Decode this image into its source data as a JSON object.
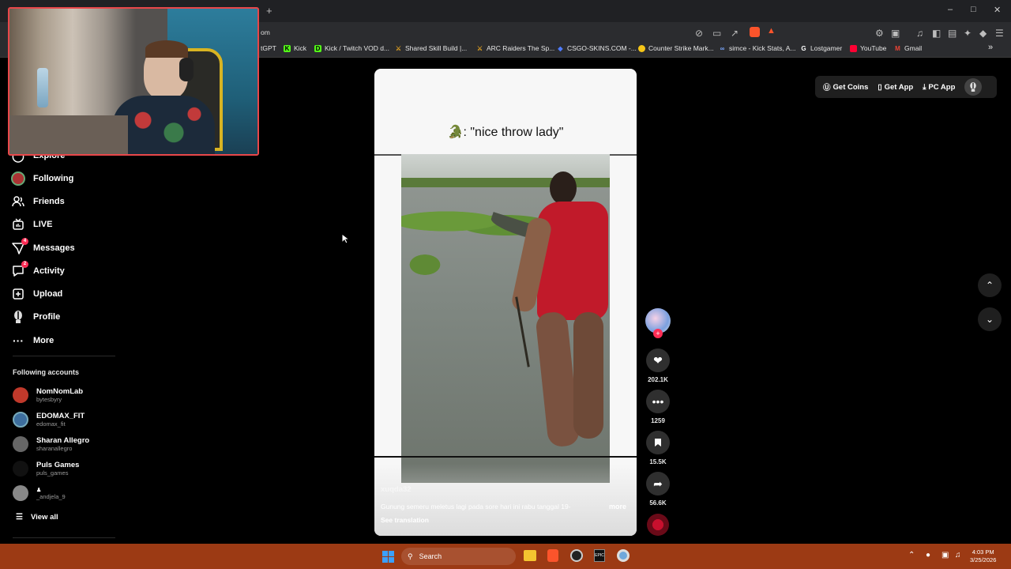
{
  "browser": {
    "address_fragment": "om",
    "new_tab_symbol": "+",
    "bookmarks": [
      {
        "label": "tGPT",
        "icon": "chatgpt-icon",
        "color": "#2b2c2f"
      },
      {
        "label": "Kick",
        "icon": "kick-icon",
        "color": "#53fc18"
      },
      {
        "label": "Kick / Twitch VOD d...",
        "icon": "kick-vod-icon",
        "color": "#53fc18"
      },
      {
        "label": "Shared Skill Build |...",
        "icon": "skill-build-icon",
        "color": "#e0a020"
      },
      {
        "label": "ARC Raiders The Sp...",
        "icon": "arc-raiders-icon",
        "color": "#e0a020"
      },
      {
        "label": "CSGO-SKINS.COM -...",
        "icon": "csgo-skins-icon",
        "color": "#4f7cff"
      },
      {
        "label": "Counter Strike Mark...",
        "icon": "cs-market-icon",
        "color": "#f5c518"
      },
      {
        "label": "simce - Kick Stats, A...",
        "icon": "kick-stats-icon",
        "color": "#7aa7ff"
      },
      {
        "label": "Lostgamer",
        "icon": "lostgamer-icon",
        "color": "#ffffff"
      },
      {
        "label": "YouTube",
        "icon": "youtube-icon",
        "color": "#ff0033"
      },
      {
        "label": "Gmail",
        "icon": "gmail-icon",
        "color": "#ea4335"
      }
    ],
    "more_bookmarks_symbol": "»"
  },
  "sidebar": {
    "items": [
      {
        "label": "Explore",
        "icon": "explore-icon",
        "badge": ""
      },
      {
        "label": "Following",
        "icon": "following-avatar-icon",
        "badge": ""
      },
      {
        "label": "Friends",
        "icon": "friends-icon",
        "badge": ""
      },
      {
        "label": "LIVE",
        "icon": "live-icon",
        "badge": ""
      },
      {
        "label": "Messages",
        "icon": "messages-icon",
        "badge": "4"
      },
      {
        "label": "Activity",
        "icon": "activity-icon",
        "badge": "2"
      },
      {
        "label": "Upload",
        "icon": "upload-icon",
        "badge": ""
      },
      {
        "label": "Profile",
        "icon": "profile-icon",
        "badge": ""
      },
      {
        "label": "More",
        "icon": "more-dots-icon",
        "badge": ""
      }
    ],
    "following_heading": "Following accounts",
    "accounts": [
      {
        "name": "NomNomLab",
        "handle": "bytesbyry",
        "color": "#c0392b"
      },
      {
        "name": "EDOMAX_FIT",
        "handle": "edomax_fit",
        "color": "#3d6e9e"
      },
      {
        "name": "Sharan Allegro",
        "handle": "sharanallegro",
        "color": "#666666"
      },
      {
        "name": "Puls Games",
        "handle": "puls_games",
        "color": "#111111"
      },
      {
        "name": "♟",
        "handle": "_andjela_9",
        "color": "#888888"
      }
    ],
    "view_all": "View all"
  },
  "video": {
    "caption": "🐊: \"nice throw lady\"",
    "author": "xuqda32",
    "description": "Gunung semeru meletus lagi pada sore hari ini rabu tanggal 19-",
    "more_label": "more",
    "see_translation": "See translation"
  },
  "actions": {
    "likes": "202.1K",
    "comments": "1259",
    "saves": "15.5K",
    "shares": "56.6K"
  },
  "header": {
    "get_coins": "Get Coins",
    "get_app": "Get App",
    "pc_app": "PC App"
  },
  "taskbar": {
    "search_label": "Search",
    "time": "4:03 PM",
    "date": "3/25/2026"
  }
}
